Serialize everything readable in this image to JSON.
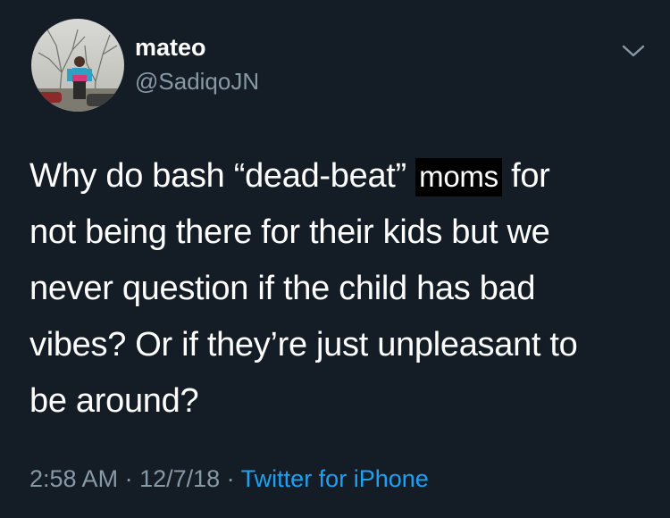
{
  "user": {
    "display_name": "mateo",
    "handle": "@SadiqoJN"
  },
  "tweet": {
    "line1_before": "Why do bash “dead-beat” ",
    "line1_highlight": "moms",
    "line1_after": " for",
    "line2": "not being there for their kids but we",
    "line3": "never question if the child has bad",
    "line4": "vibes? Or if they’re just unpleasant to",
    "line5": "be around?"
  },
  "meta": {
    "time": "2:58 AM",
    "separator1": " · ",
    "date": "12/7/18",
    "separator2": " · ",
    "source": "Twitter for iPhone"
  },
  "icons": {
    "menu": "chevron-down-icon",
    "avatar": "avatar"
  },
  "colors": {
    "background": "#141d26",
    "text": "#ffffff",
    "secondary_text": "#8899a6",
    "link": "#1da1f2",
    "highlight": "#000000"
  }
}
